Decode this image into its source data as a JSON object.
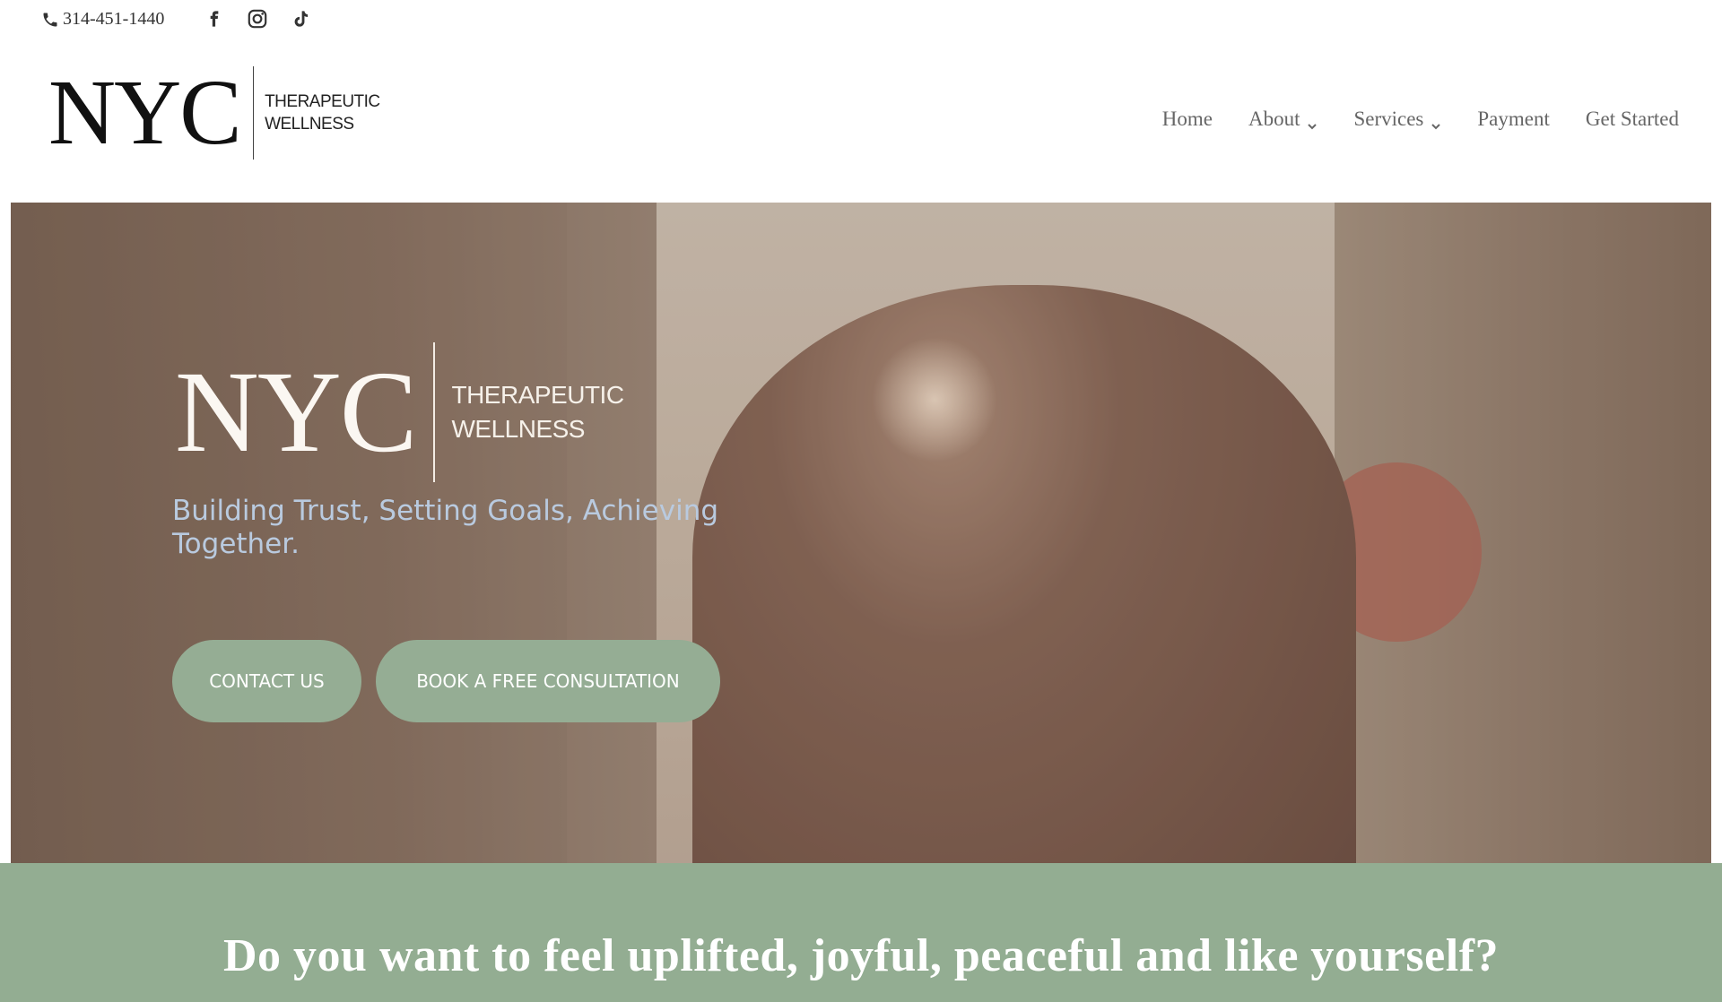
{
  "topbar": {
    "phone": "314-451-1440",
    "social": [
      {
        "icon": "facebook-icon"
      },
      {
        "icon": "instagram-icon"
      },
      {
        "icon": "tiktok-icon"
      }
    ]
  },
  "header": {
    "logo_main": "NYC",
    "logo_sub_line1": "THERAPEUTIC",
    "logo_sub_line2": "WELLNESS",
    "nav": [
      {
        "label": "Home"
      },
      {
        "label": "About"
      },
      {
        "label": "Services"
      },
      {
        "label": "Payment"
      },
      {
        "label": "Get Started"
      }
    ]
  },
  "hero": {
    "logo_main": "NYC",
    "logo_sub_line1": "THERAPEUTIC",
    "logo_sub_line2": "WELLNESS",
    "tagline": "Building Trust, Setting Goals, Achieving Together.",
    "contact_button": "CONTACT US",
    "book_button": "BOOK A FREE CONSULTATION"
  },
  "band": {
    "headline": "Do you want to feel uplifted, joyful, peaceful and like yourself?"
  },
  "colors": {
    "accent_green": "#93ad92",
    "tagline_blue": "#b9cadf",
    "nav_text": "#666666"
  }
}
